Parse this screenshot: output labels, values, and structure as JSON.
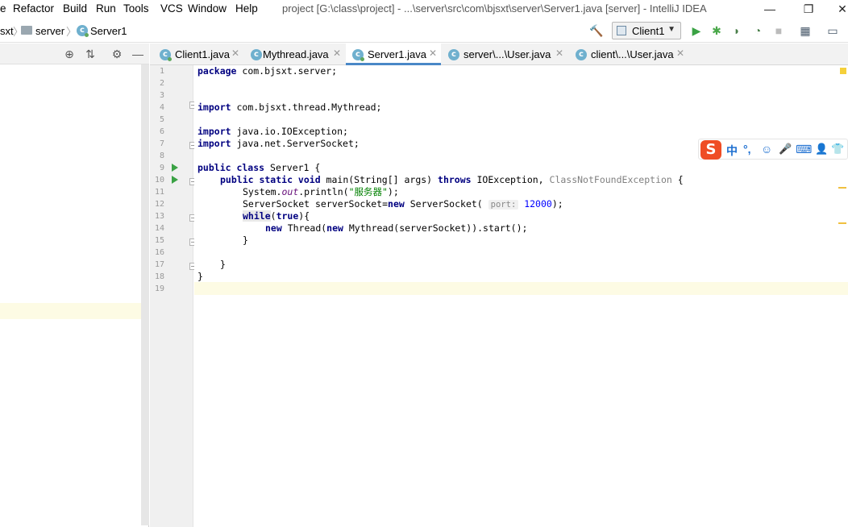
{
  "menu": [
    "e",
    "Refactor",
    "Build",
    "Run",
    "Tools",
    "VCS",
    "Window",
    "Help"
  ],
  "window_title": "project [G:\\class\\project] - ...\\server\\src\\com\\bjsxt\\server\\Server1.java [server] - IntelliJ IDEA",
  "breadcrumbs": [
    "sxt",
    "server",
    "Server1"
  ],
  "run_config": {
    "label": "Client1"
  },
  "tabs": [
    {
      "label": "Client1.java"
    },
    {
      "label": "Mythread.java"
    },
    {
      "label": "Server1.java"
    },
    {
      "label": "server\\...\\User.java"
    },
    {
      "label": "client\\...\\User.java"
    }
  ],
  "line_numbers": [
    "1",
    "2",
    "3",
    "4",
    "5",
    "6",
    "7",
    "8",
    "9",
    "10",
    "11",
    "12",
    "13",
    "14",
    "15",
    "16",
    "17",
    "18",
    "19"
  ],
  "code": {
    "l1_kw": "package",
    "l1_rest": " com.bjsxt.server;",
    "l4_kw": "import",
    "l4_rest": " com.bjsxt.thread.Mythread;",
    "l6_kw": "import",
    "l6_rest": " java.io.IOException;",
    "l7_kw": "import",
    "l7_rest": " java.net.ServerSocket;",
    "l9_kw": "public class",
    "l9_rest": " Server1 {",
    "l10_kw1": "public static void",
    "l10_mid": " main(String[] args) ",
    "l10_kw2": "throws",
    "l10_t1": " IOException, ",
    "l10_gray": "ClassNotFoundException",
    "l10_end": " {",
    "l11_a": "System.",
    "l11_out": "out",
    "l11_b": ".println(",
    "l11_str": "\"服务器\"",
    "l11_c": ");",
    "l12_a": "ServerSocket serverSocket=",
    "l12_kw": "new",
    "l12_b": " ServerSocket( ",
    "l12_hint": "port:",
    "l12_num": "12000",
    "l12_c": ");",
    "l13_kw": "while",
    "l13_b": "(",
    "l13_kw2": "true",
    "l13_c": "){",
    "l14_kw": "new",
    "l14_b": " Thread(",
    "l14_kw2": "new",
    "l14_c": " Mythread(serverSocket)).start();",
    "l15": "}",
    "l17": "}",
    "l18": "}"
  },
  "ime": {
    "logo": "S",
    "lang": "中",
    "punct": "°,",
    "emoji": "☺",
    "mic": "🎤",
    "keyboard": "⌨",
    "user": "👤",
    "shirt": "👕"
  }
}
